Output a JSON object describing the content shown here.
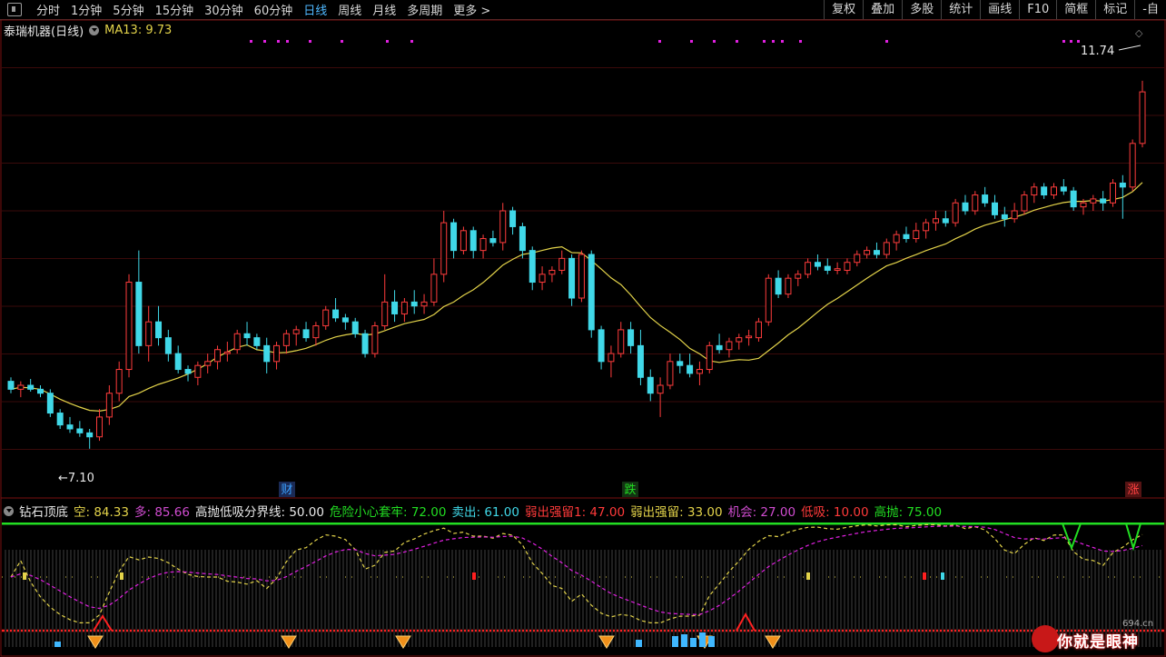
{
  "toolbar": {
    "items": [
      {
        "label": "分时",
        "active": false
      },
      {
        "label": "1分钟",
        "active": false
      },
      {
        "label": "5分钟",
        "active": false
      },
      {
        "label": "15分钟",
        "active": false
      },
      {
        "label": "30分钟",
        "active": false
      },
      {
        "label": "60分钟",
        "active": false
      },
      {
        "label": "日线",
        "active": true
      },
      {
        "label": "周线",
        "active": false
      },
      {
        "label": "月线",
        "active": false
      },
      {
        "label": "多周期",
        "active": false
      },
      {
        "label": "更多 >",
        "active": false
      }
    ],
    "right": [
      "复权",
      "叠加",
      "多股",
      "统计",
      "画线",
      "F10",
      "简框",
      "标记",
      "-自"
    ]
  },
  "stock": {
    "name": "泰瑞机器",
    "period": "(日线)",
    "ma_label": "MA13: 9.73"
  },
  "price_labels": {
    "high": "11.74",
    "low": "7.10"
  },
  "event_markers": [
    {
      "label": "财",
      "color": "#3aa0ff",
      "bg": "#1a2a55"
    },
    {
      "label": "跌",
      "color": "#22dd22",
      "bg": "#123312"
    },
    {
      "label": "涨",
      "color": "#ff4040",
      "bg": "#551414"
    }
  ],
  "indicator": {
    "name": "钻石顶底",
    "params": [
      {
        "label": "空: 84.33",
        "color": "#e3d34a"
      },
      {
        "label": "多: 85.66",
        "color": "#d04cd0"
      },
      {
        "label": "高抛低吸分界线: 50.00",
        "color": "#e8e8e8"
      },
      {
        "label": "危险小心套牢: 72.00",
        "color": "#22dd22"
      },
      {
        "label": "卖出: 61.00",
        "color": "#40d8e8"
      },
      {
        "label": "弱出强留1: 47.00",
        "color": "#ff3a3a"
      },
      {
        "label": "弱出强留: 33.00",
        "color": "#e3d34a"
      },
      {
        "label": "机会: 27.00",
        "color": "#d04cd0"
      },
      {
        "label": "低吸: 10.00",
        "color": "#ff3a3a"
      },
      {
        "label": "高抛: 75.00",
        "color": "#22dd22"
      }
    ]
  },
  "colors": {
    "up": "#ff3c3c",
    "down": "#40d8e8",
    "ma": "#e3d34a",
    "magenta": "#e020e0"
  },
  "watermark": {
    "text": "你就是眼神",
    "site": "694.cn"
  },
  "chart_data": {
    "type": "candlestick",
    "ylim": [
      6.8,
      12.3
    ],
    "ma_period": 13,
    "ohlc": [
      [
        7.95,
        8.0,
        7.8,
        7.85
      ],
      [
        7.85,
        7.95,
        7.75,
        7.9
      ],
      [
        7.9,
        7.98,
        7.82,
        7.85
      ],
      [
        7.85,
        7.9,
        7.75,
        7.8
      ],
      [
        7.8,
        7.85,
        7.5,
        7.55
      ],
      [
        7.55,
        7.6,
        7.35,
        7.4
      ],
      [
        7.4,
        7.5,
        7.3,
        7.35
      ],
      [
        7.35,
        7.45,
        7.25,
        7.3
      ],
      [
        7.3,
        7.35,
        7.1,
        7.25
      ],
      [
        7.25,
        7.6,
        7.2,
        7.5
      ],
      [
        7.5,
        7.9,
        7.4,
        7.8
      ],
      [
        7.8,
        8.2,
        7.7,
        8.1
      ],
      [
        8.1,
        9.3,
        8.0,
        9.2
      ],
      [
        9.2,
        9.6,
        8.3,
        8.4
      ],
      [
        8.4,
        8.9,
        8.2,
        8.7
      ],
      [
        8.7,
        8.9,
        8.4,
        8.5
      ],
      [
        8.5,
        8.6,
        8.2,
        8.3
      ],
      [
        8.3,
        8.4,
        8.05,
        8.1
      ],
      [
        8.1,
        8.15,
        7.95,
        8.05
      ],
      [
        8.0,
        8.2,
        7.9,
        8.15
      ],
      [
        8.15,
        8.3,
        8.05,
        8.2
      ],
      [
        8.2,
        8.4,
        8.1,
        8.35
      ],
      [
        8.3,
        8.45,
        8.2,
        8.32
      ],
      [
        8.35,
        8.6,
        8.3,
        8.55
      ],
      [
        8.55,
        8.7,
        8.4,
        8.5
      ],
      [
        8.5,
        8.55,
        8.35,
        8.4
      ],
      [
        8.4,
        8.5,
        8.05,
        8.2
      ],
      [
        8.2,
        8.45,
        8.1,
        8.4
      ],
      [
        8.4,
        8.6,
        8.3,
        8.55
      ],
      [
        8.55,
        8.65,
        8.4,
        8.6
      ],
      [
        8.6,
        8.7,
        8.45,
        8.5
      ],
      [
        8.5,
        8.7,
        8.4,
        8.65
      ],
      [
        8.65,
        8.9,
        8.6,
        8.85
      ],
      [
        8.85,
        9.0,
        8.7,
        8.75
      ],
      [
        8.75,
        8.8,
        8.6,
        8.7
      ],
      [
        8.7,
        8.75,
        8.5,
        8.55
      ],
      [
        8.55,
        8.6,
        8.25,
        8.3
      ],
      [
        8.3,
        8.7,
        8.25,
        8.65
      ],
      [
        8.65,
        9.3,
        8.6,
        8.95
      ],
      [
        8.95,
        9.1,
        8.7,
        8.8
      ],
      [
        8.8,
        9.0,
        8.7,
        8.95
      ],
      [
        8.95,
        9.1,
        8.8,
        8.9
      ],
      [
        8.9,
        9.05,
        8.8,
        8.95
      ],
      [
        8.95,
        9.5,
        8.9,
        9.3
      ],
      [
        9.3,
        10.1,
        9.2,
        9.95
      ],
      [
        9.95,
        10.0,
        9.5,
        9.6
      ],
      [
        9.6,
        9.9,
        9.55,
        9.85
      ],
      [
        9.85,
        9.9,
        9.5,
        9.6
      ],
      [
        9.6,
        9.8,
        9.5,
        9.75
      ],
      [
        9.75,
        9.85,
        9.65,
        9.7
      ],
      [
        9.7,
        10.2,
        9.6,
        10.1
      ],
      [
        10.1,
        10.15,
        9.8,
        9.9
      ],
      [
        9.9,
        9.95,
        9.5,
        9.6
      ],
      [
        9.6,
        9.65,
        9.1,
        9.2
      ],
      [
        9.2,
        9.4,
        9.1,
        9.3
      ],
      [
        9.3,
        9.4,
        9.2,
        9.35
      ],
      [
        9.35,
        9.6,
        9.3,
        9.5
      ],
      [
        9.5,
        9.55,
        8.9,
        9.0
      ],
      [
        9.0,
        9.6,
        8.95,
        9.55
      ],
      [
        9.55,
        9.6,
        8.5,
        8.6
      ],
      [
        8.6,
        8.65,
        8.1,
        8.2
      ],
      [
        8.2,
        8.4,
        8.0,
        8.3
      ],
      [
        8.3,
        8.7,
        8.25,
        8.6
      ],
      [
        8.6,
        8.7,
        8.3,
        8.4
      ],
      [
        8.4,
        8.6,
        7.9,
        8.0
      ],
      [
        8.0,
        8.1,
        7.7,
        7.8
      ],
      [
        7.8,
        8.0,
        7.5,
        7.9
      ],
      [
        7.9,
        8.3,
        7.85,
        8.2
      ],
      [
        8.2,
        8.3,
        8.05,
        8.15
      ],
      [
        8.15,
        8.3,
        8.0,
        8.05
      ],
      [
        8.05,
        8.2,
        7.9,
        8.1
      ],
      [
        8.1,
        8.45,
        8.05,
        8.4
      ],
      [
        8.4,
        8.55,
        8.3,
        8.35
      ],
      [
        8.35,
        8.5,
        8.25,
        8.45
      ],
      [
        8.45,
        8.55,
        8.35,
        8.5
      ],
      [
        8.5,
        8.6,
        8.4,
        8.52
      ],
      [
        8.5,
        8.75,
        8.45,
        8.7
      ],
      [
        8.7,
        9.3,
        8.65,
        9.25
      ],
      [
        9.25,
        9.35,
        9.0,
        9.05
      ],
      [
        9.05,
        9.3,
        9.0,
        9.25
      ],
      [
        9.25,
        9.35,
        9.15,
        9.3
      ],
      [
        9.3,
        9.5,
        9.25,
        9.45
      ],
      [
        9.45,
        9.55,
        9.35,
        9.4
      ],
      [
        9.4,
        9.5,
        9.3,
        9.35
      ],
      [
        9.35,
        9.45,
        9.3,
        9.37
      ],
      [
        9.35,
        9.5,
        9.3,
        9.45
      ],
      [
        9.45,
        9.6,
        9.4,
        9.55
      ],
      [
        9.55,
        9.65,
        9.5,
        9.6
      ],
      [
        9.6,
        9.7,
        9.5,
        9.55
      ],
      [
        9.55,
        9.75,
        9.5,
        9.7
      ],
      [
        9.7,
        9.85,
        9.6,
        9.8
      ],
      [
        9.8,
        9.9,
        9.7,
        9.75
      ],
      [
        9.75,
        9.95,
        9.7,
        9.85
      ],
      [
        9.85,
        10.0,
        9.75,
        9.95
      ],
      [
        9.95,
        10.1,
        9.85,
        10.0
      ],
      [
        10.0,
        10.1,
        9.9,
        9.95
      ],
      [
        9.95,
        10.25,
        9.9,
        10.2
      ],
      [
        10.2,
        10.3,
        10.05,
        10.1
      ],
      [
        10.1,
        10.35,
        10.05,
        10.3
      ],
      [
        10.3,
        10.4,
        10.15,
        10.2
      ],
      [
        10.2,
        10.3,
        10.0,
        10.05
      ],
      [
        10.05,
        10.15,
        9.9,
        10.0
      ],
      [
        10.0,
        10.2,
        9.95,
        10.1
      ],
      [
        10.1,
        10.35,
        10.05,
        10.3
      ],
      [
        10.3,
        10.45,
        10.2,
        10.4
      ],
      [
        10.4,
        10.45,
        10.25,
        10.3
      ],
      [
        10.3,
        10.45,
        10.25,
        10.4
      ],
      [
        10.4,
        10.5,
        10.3,
        10.35
      ],
      [
        10.35,
        10.4,
        10.1,
        10.15
      ],
      [
        10.15,
        10.25,
        10.05,
        10.2
      ],
      [
        10.2,
        10.3,
        10.1,
        10.25
      ],
      [
        10.25,
        10.35,
        10.1,
        10.2
      ],
      [
        10.2,
        10.5,
        10.15,
        10.45
      ],
      [
        10.45,
        10.55,
        10.0,
        10.4
      ],
      [
        10.4,
        11.0,
        10.35,
        10.95
      ],
      [
        10.95,
        11.74,
        10.9,
        11.6
      ]
    ]
  }
}
